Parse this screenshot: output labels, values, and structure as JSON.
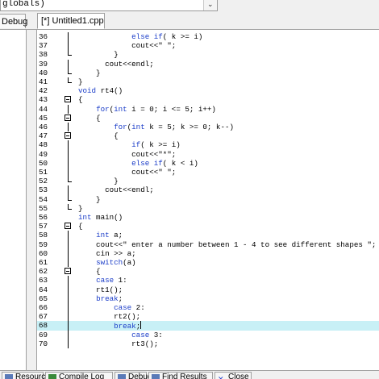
{
  "scope": {
    "text": "globals)",
    "dropdown_glyph": "⌄"
  },
  "tabs": {
    "left_panel": "Debug",
    "file": "[*] Untitled1.cpp"
  },
  "editor": {
    "lines": [
      {
        "n": "36",
        "segs": [
          {
            "t": "            "
          },
          {
            "t": "else if",
            "k": true
          },
          {
            "t": "( k >= i)"
          }
        ],
        "fold": "vert"
      },
      {
        "n": "37",
        "segs": [
          {
            "t": "            cout<<\" \";"
          }
        ],
        "fold": "vert"
      },
      {
        "n": "38",
        "segs": [
          {
            "t": "        }"
          }
        ],
        "fold": "end"
      },
      {
        "n": "39",
        "segs": [
          {
            "t": "      cout<<endl;"
          }
        ],
        "fold": "vert"
      },
      {
        "n": "40",
        "segs": [
          {
            "t": "    }"
          }
        ],
        "fold": "end"
      },
      {
        "n": "41",
        "segs": [
          {
            "t": "}"
          }
        ],
        "fold": "end"
      },
      {
        "n": "42",
        "segs": [
          {
            "t": "void",
            "k": true
          },
          {
            "t": " rt4()"
          }
        ],
        "fold": ""
      },
      {
        "n": "43",
        "segs": [
          {
            "t": "{"
          }
        ],
        "fold": "box"
      },
      {
        "n": "44",
        "segs": [
          {
            "t": "    "
          },
          {
            "t": "for",
            "k": true
          },
          {
            "t": "("
          },
          {
            "t": "int",
            "k": true
          },
          {
            "t": " i = 0; i <= 5; i++)"
          }
        ],
        "fold": "vert"
      },
      {
        "n": "45",
        "segs": [
          {
            "t": "    {"
          }
        ],
        "fold": "box"
      },
      {
        "n": "46",
        "segs": [
          {
            "t": "        "
          },
          {
            "t": "for",
            "k": true
          },
          {
            "t": "("
          },
          {
            "t": "int",
            "k": true
          },
          {
            "t": " k = 5; k >= 0; k--)"
          }
        ],
        "fold": "vert"
      },
      {
        "n": "47",
        "segs": [
          {
            "t": "        {"
          }
        ],
        "fold": "box"
      },
      {
        "n": "48",
        "segs": [
          {
            "t": "            "
          },
          {
            "t": "if",
            "k": true
          },
          {
            "t": "( k >= i)"
          }
        ],
        "fold": "vert"
      },
      {
        "n": "49",
        "segs": [
          {
            "t": "            cout<<\"*\";"
          }
        ],
        "fold": "vert"
      },
      {
        "n": "50",
        "segs": [
          {
            "t": "            "
          },
          {
            "t": "else if",
            "k": true
          },
          {
            "t": "( k < i)"
          }
        ],
        "fold": "vert"
      },
      {
        "n": "51",
        "segs": [
          {
            "t": "            cout<<\" \";"
          }
        ],
        "fold": "vert"
      },
      {
        "n": "52",
        "segs": [
          {
            "t": "        }"
          }
        ],
        "fold": "end"
      },
      {
        "n": "53",
        "segs": [
          {
            "t": "      cout<<endl;"
          }
        ],
        "fold": "vert"
      },
      {
        "n": "54",
        "segs": [
          {
            "t": "    }"
          }
        ],
        "fold": "end"
      },
      {
        "n": "55",
        "segs": [
          {
            "t": "}"
          }
        ],
        "fold": "end"
      },
      {
        "n": "56",
        "segs": [
          {
            "t": "int",
            "k": true
          },
          {
            "t": " main()"
          }
        ],
        "fold": ""
      },
      {
        "n": "57",
        "segs": [
          {
            "t": "{"
          }
        ],
        "fold": "box"
      },
      {
        "n": "58",
        "segs": [
          {
            "t": "    "
          },
          {
            "t": "int",
            "k": true
          },
          {
            "t": " a;"
          }
        ],
        "fold": "vert"
      },
      {
        "n": "59",
        "segs": [
          {
            "t": "    cout<<\" enter a number between 1 - 4 to see different shapes \";"
          }
        ],
        "fold": "vert"
      },
      {
        "n": "60",
        "segs": [
          {
            "t": "    cin >> a;"
          }
        ],
        "fold": "vert"
      },
      {
        "n": "61",
        "segs": [
          {
            "t": "    "
          },
          {
            "t": "switch",
            "k": true
          },
          {
            "t": "(a)"
          }
        ],
        "fold": "vert"
      },
      {
        "n": "62",
        "segs": [
          {
            "t": "    {"
          }
        ],
        "fold": "box"
      },
      {
        "n": "63",
        "segs": [
          {
            "t": "    "
          },
          {
            "t": "case",
            "k": true
          },
          {
            "t": " 1:"
          }
        ],
        "fold": "vert"
      },
      {
        "n": "64",
        "segs": [
          {
            "t": "    rt1();"
          }
        ],
        "fold": "vert"
      },
      {
        "n": "65",
        "segs": [
          {
            "t": "    "
          },
          {
            "t": "break",
            "k": true
          },
          {
            "t": ";"
          }
        ],
        "fold": "vert"
      },
      {
        "n": "66",
        "segs": [
          {
            "t": "        "
          },
          {
            "t": "case",
            "k": true
          },
          {
            "t": " 2:"
          }
        ],
        "fold": "vert"
      },
      {
        "n": "67",
        "segs": [
          {
            "t": "        rt2();"
          }
        ],
        "fold": "vert"
      },
      {
        "n": "68",
        "segs": [
          {
            "t": "        "
          },
          {
            "t": "break",
            "k": true
          },
          {
            "t": ";"
          }
        ],
        "fold": "vert",
        "highlight": true,
        "caret": true
      },
      {
        "n": "69",
        "segs": [
          {
            "t": "            "
          },
          {
            "t": "case",
            "k": true
          },
          {
            "t": " 3:"
          }
        ],
        "fold": "vert"
      },
      {
        "n": "70",
        "segs": [
          {
            "t": "            rt3();"
          }
        ],
        "fold": "vert"
      }
    ]
  },
  "bottom_tabs": [
    {
      "label": "Resources",
      "icon": "resources-icon"
    },
    {
      "label": "Compile Log",
      "icon": "compile-log-icon"
    },
    {
      "label": "Debug",
      "icon": "debug-icon"
    },
    {
      "label": "Find Results",
      "icon": "find-results-icon"
    },
    {
      "label": "Close",
      "icon": "close-icon"
    }
  ]
}
